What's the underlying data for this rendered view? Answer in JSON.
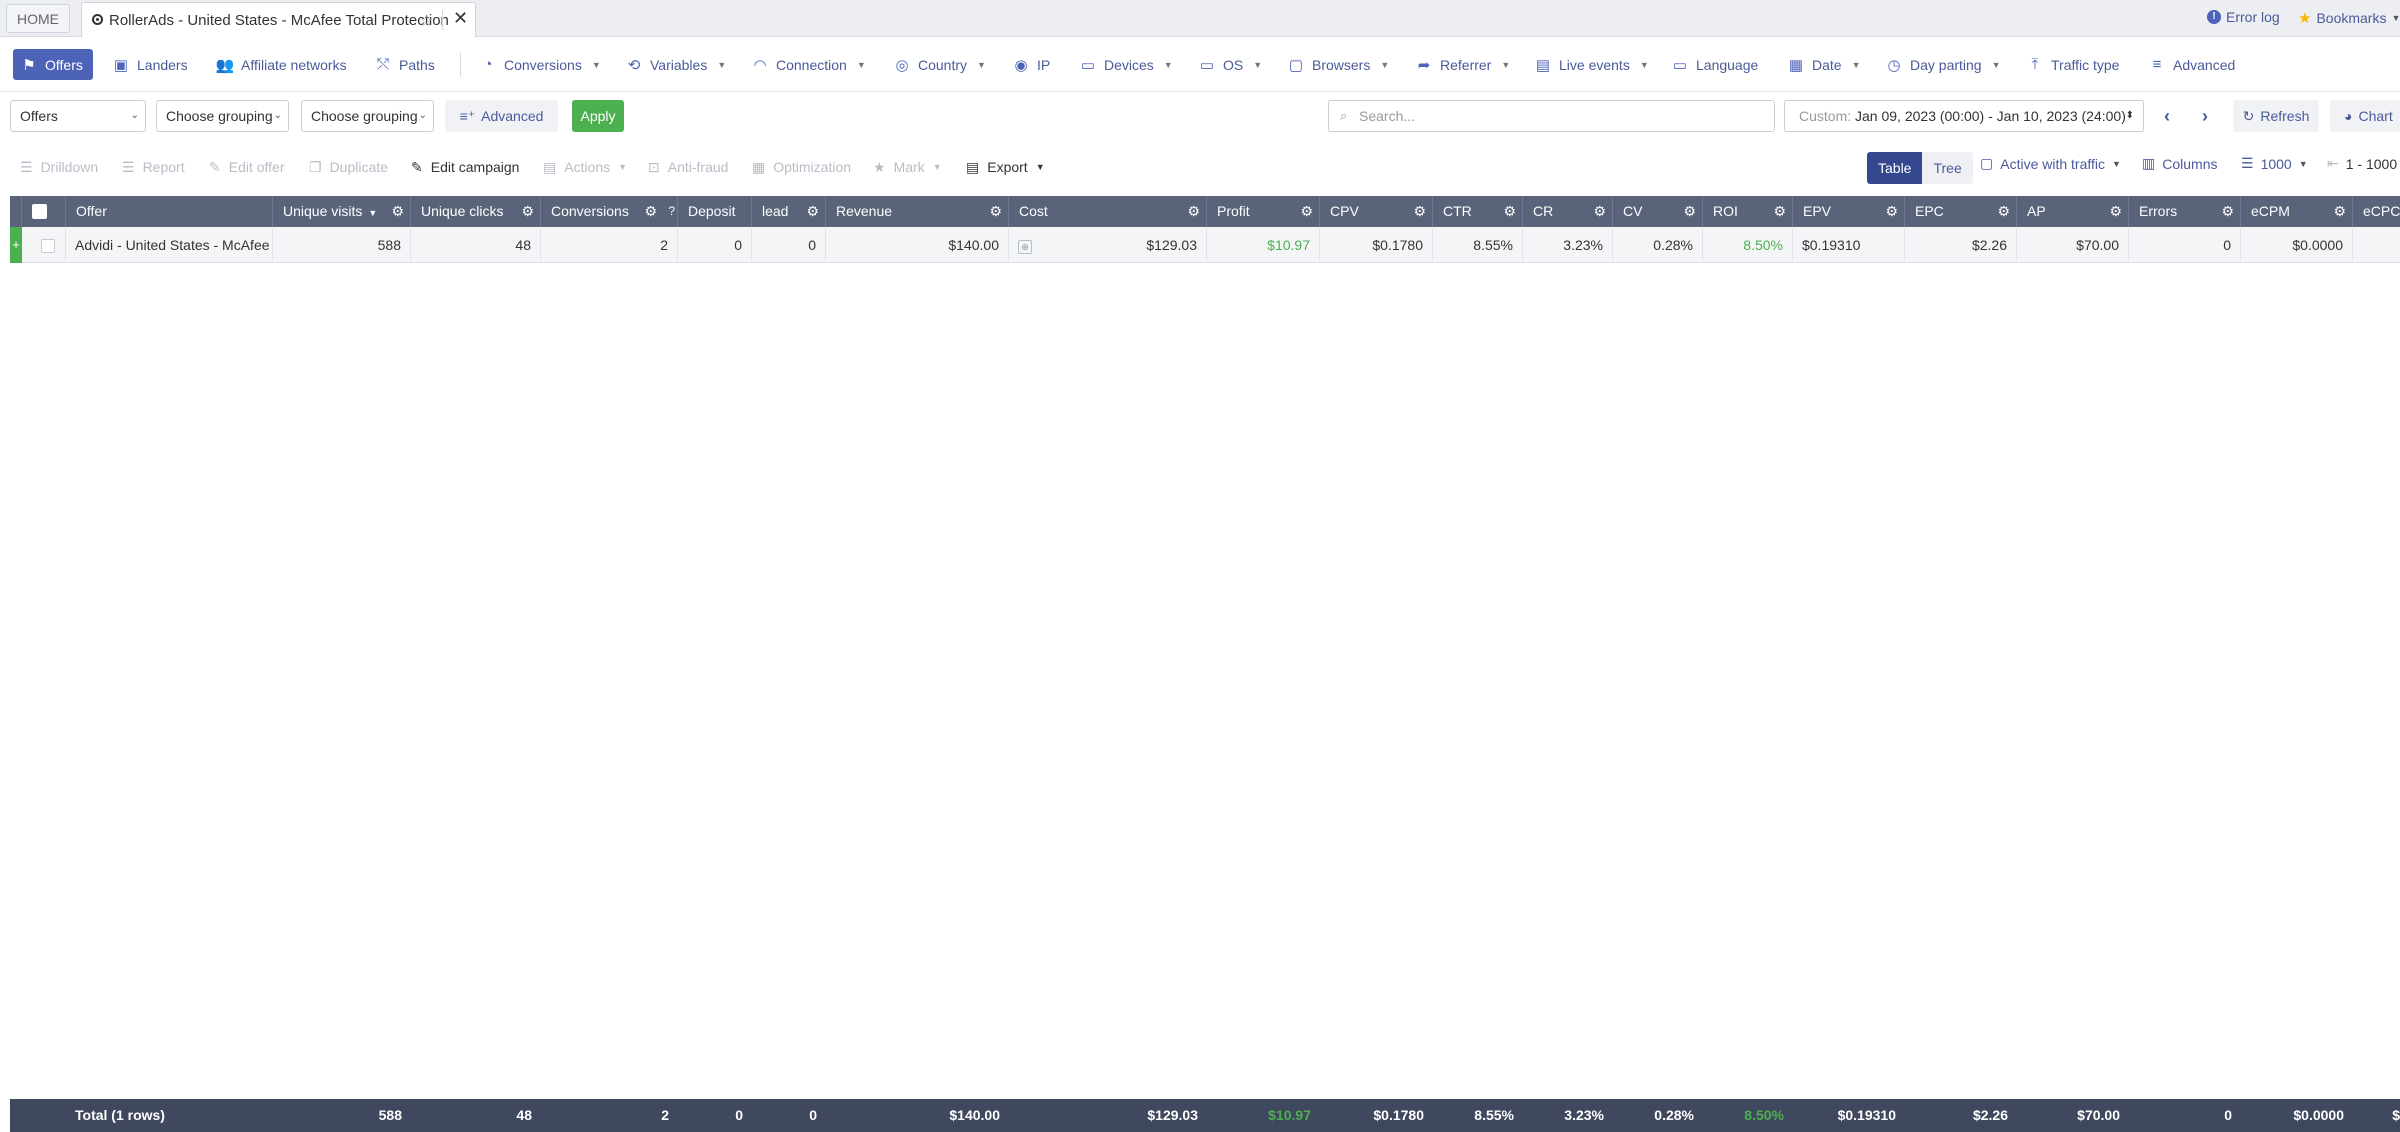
{
  "tabbar": {
    "home": "HOME",
    "active_tab": "RollerAds - United States - McAfee Total Protection",
    "error_log": "Error log",
    "bookmarks": "Bookmarks"
  },
  "nav": {
    "offers": "Offers",
    "landers": "Landers",
    "affiliate_networks": "Affiliate networks",
    "paths": "Paths",
    "conversions": "Conversions",
    "variables": "Variables",
    "connection": "Connection",
    "country": "Country",
    "ip": "IP",
    "devices": "Devices",
    "os": "OS",
    "browsers": "Browsers",
    "referrer": "Referrer",
    "live_events": "Live events",
    "language": "Language",
    "date": "Date",
    "day_parting": "Day parting",
    "traffic_type": "Traffic type",
    "advanced": "Advanced"
  },
  "filters": {
    "entity_select": "Offers",
    "grouping_1": "Choose grouping",
    "grouping_2": "Choose grouping",
    "advanced": "Advanced",
    "apply": "Apply",
    "search_placeholder": "Search...",
    "date_label": "Custom:",
    "date_value": "Jan 09, 2023 (00:00) - Jan 10, 2023 (24:00)",
    "refresh": "Refresh",
    "chart": "Chart"
  },
  "toolbar": {
    "drilldown": "Drilldown",
    "report": "Report",
    "edit_offer": "Edit offer",
    "duplicate": "Duplicate",
    "edit_campaign": "Edit campaign",
    "actions": "Actions",
    "anti_fraud": "Anti-fraud",
    "optimization": "Optimization",
    "mark": "Mark",
    "export": "Export",
    "view_table": "Table",
    "view_tree": "Tree",
    "traffic_filter": "Active with traffic",
    "columns": "Columns",
    "page_size": "1000",
    "pagination": "1 - 1000"
  },
  "table": {
    "headers": {
      "offer": "Offer",
      "unique_visits": "Unique visits",
      "unique_clicks": "Unique clicks",
      "conversions": "Conversions",
      "deposit": "Deposit",
      "lead": "lead",
      "revenue": "Revenue",
      "cost": "Cost",
      "profit": "Profit",
      "cpv": "CPV",
      "ctr": "CTR",
      "cr": "CR",
      "cv": "CV",
      "roi": "ROI",
      "epv": "EPV",
      "epc": "EPC",
      "ap": "AP",
      "errors": "Errors",
      "ecpm": "eCPM",
      "ecpc": "eCPC"
    },
    "rows": [
      {
        "offer": "Advidi - United States - McAfee",
        "unique_visits": "588",
        "unique_clicks": "48",
        "conversions": "2",
        "deposit": "0",
        "lead": "0",
        "revenue": "$140.00",
        "cost": "$129.03",
        "profit": "$10.97",
        "cpv": "$0.1780",
        "ctr": "8.55%",
        "cr": "3.23%",
        "cv": "0.28%",
        "roi": "8.50%",
        "epv": "$0.19310",
        "epc": "$2.26",
        "ap": "$70.00",
        "errors": "0",
        "ecpm": "$0.0000",
        "ecpc": "$"
      }
    ],
    "total": {
      "label": "Total (1 rows)",
      "unique_visits": "588",
      "unique_clicks": "48",
      "conversions": "2",
      "deposit": "0",
      "lead": "0",
      "revenue": "$140.00",
      "cost": "$129.03",
      "profit": "$10.97",
      "cpv": "$0.1780",
      "ctr": "8.55%",
      "cr": "3.23%",
      "cv": "0.28%",
      "roi": "8.50%",
      "epv": "$0.19310",
      "epc": "$2.26",
      "ap": "$70.00",
      "errors": "0",
      "ecpm": "$0.0000",
      "ecpc": "$"
    }
  },
  "colors": {
    "accent": "#4d63b7",
    "header_bg": "#59637a",
    "footer_bg": "#3f485e",
    "positive": "#4caf50"
  }
}
